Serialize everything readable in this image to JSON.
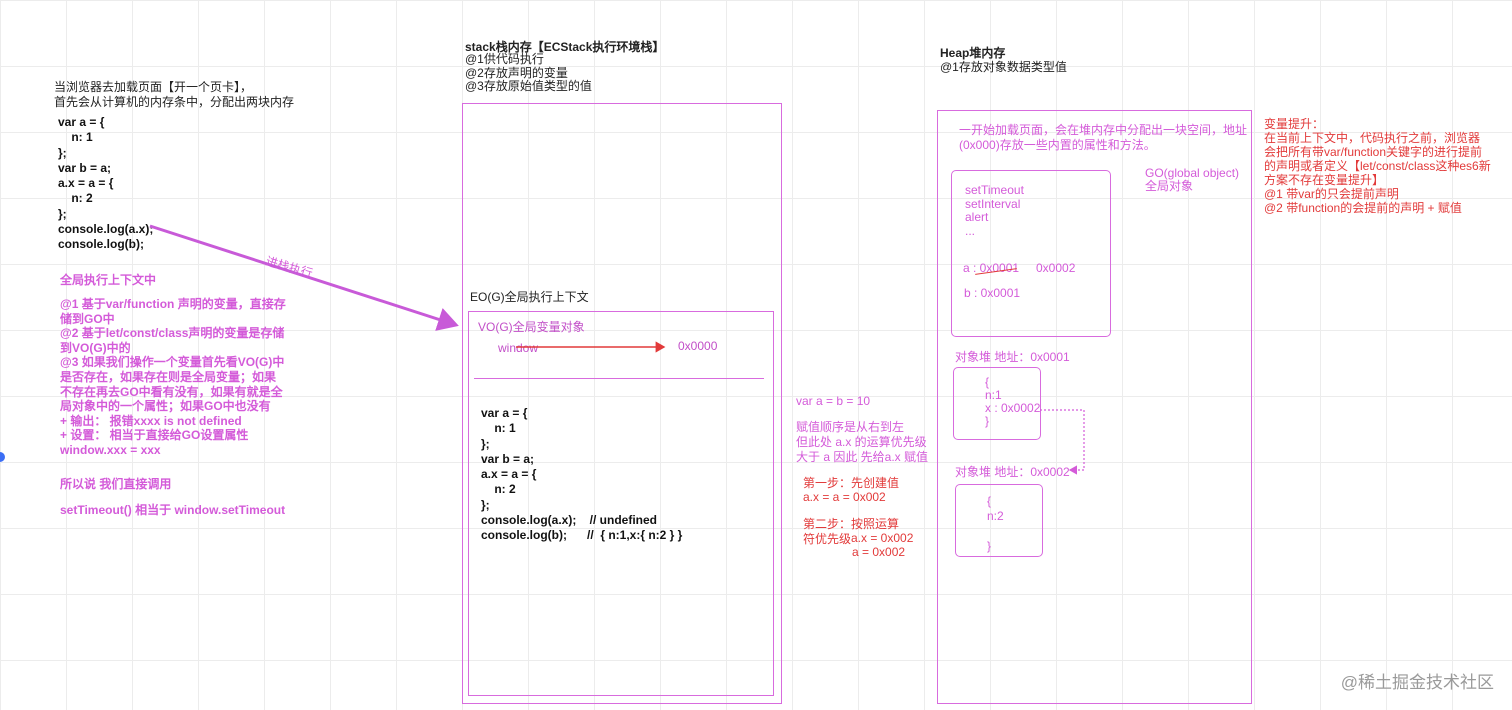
{
  "left": {
    "intro": "当浏览器去加载页面【开一个页卡】，\n首先会从计算机的内存条中，分配出两块内存",
    "code": "var a = {\n    n: 1\n};\nvar b = a;\na.x = a = {\n    n: 2\n};\nconsole.log(a.x);\nconsole.log(b);",
    "arrow_label": "进栈执行",
    "gec_title": "全局执行上下文中",
    "gec_notes": "@1 基于var/function 声明的变量，直接存\n储到GO中\n@2 基于let/const/class声明的变量是存储\n到VO(G)中的\n@3 如果我们操作一个变量首先看VO(G)中\n是否存在，如果存在则是全局变量；如果\n不存在再去GO中看有没有，如果有就是全\n局对象中的一个属性；如果GO中也没有\n + 输出：  报错xxxx is not defined\n + 设置：  相当于直接给GO设置属性\n              window.xxx = xxx",
    "summary": "所以说 我们直接调用",
    "timeout_note": "setTimeout()  相当于 window.setTimeout"
  },
  "stack": {
    "title": "stack栈内存【ECStack执行环境栈】",
    "desc": "@1供代码执行\n@2存放声明的变量\n@3存放原始值类型的值",
    "ec_label": "EO(G)全局执行上下文",
    "vo_label": "VO(G)全局变量对象",
    "window_label": "window",
    "window_addr": "0x0000",
    "code": "var a = {\n    n: 1\n};\nvar b = a;\na.x = a = {\n    n: 2\n};\nconsole.log(a.x);    // undefined\nconsole.log(b);      //  { n:1,x:{ n:2 } }"
  },
  "middle": {
    "expr": "var a = b = 10",
    "order_note": "赋值顺序是从右到左\n但此处 a.x 的运算优先级\n大于 a 因此 先给a.x 赋值",
    "step1_title": "第一步：先创建值",
    "step1_code": "a.x = a = 0x002",
    "step2_title": "第二步：按照运算\n符优先级",
    "step2_code1": "a.x = 0x002",
    "step2_code2": "a = 0x002"
  },
  "heap": {
    "title": "Heap堆内存",
    "desc": "@1存放对象数据类型值",
    "intro": "一开始加载页面，会在堆内存中分配出一块空间，地址\n(0x000)存放一些内置的属性和方法。",
    "go_label": "GO(global object)\n全局对象",
    "go_props": "setTimeout\nsetInterval\nalert\n...",
    "go_a": "a : 0x0001",
    "go_a_new": "0x0002",
    "go_b": "b : 0x0001",
    "obj1_title": "对象堆 地址：0x0001",
    "obj1_body": "{\n n:1\nx : 0x0002\n}",
    "obj2_title": "对象堆 地址：0x0002",
    "obj2_body": "{\nn:2\n\n}"
  },
  "hoisting": {
    "title": "变量提升：",
    "body": "在当前上下文中，代码执行之前，浏览器\n会把所有带var/function关键字的进行提前\n的声明或者定义【let/const/class这种es6新\n方案不存在变量提升】\n@1 带var的只会提前声明\n@2 带function的会提前的声明 + 赋值"
  },
  "watermark": "@稀土掘金技术社区",
  "colors": {
    "magenta": "#d45bd9",
    "red": "#e23a3a",
    "grid": "#ececec"
  }
}
